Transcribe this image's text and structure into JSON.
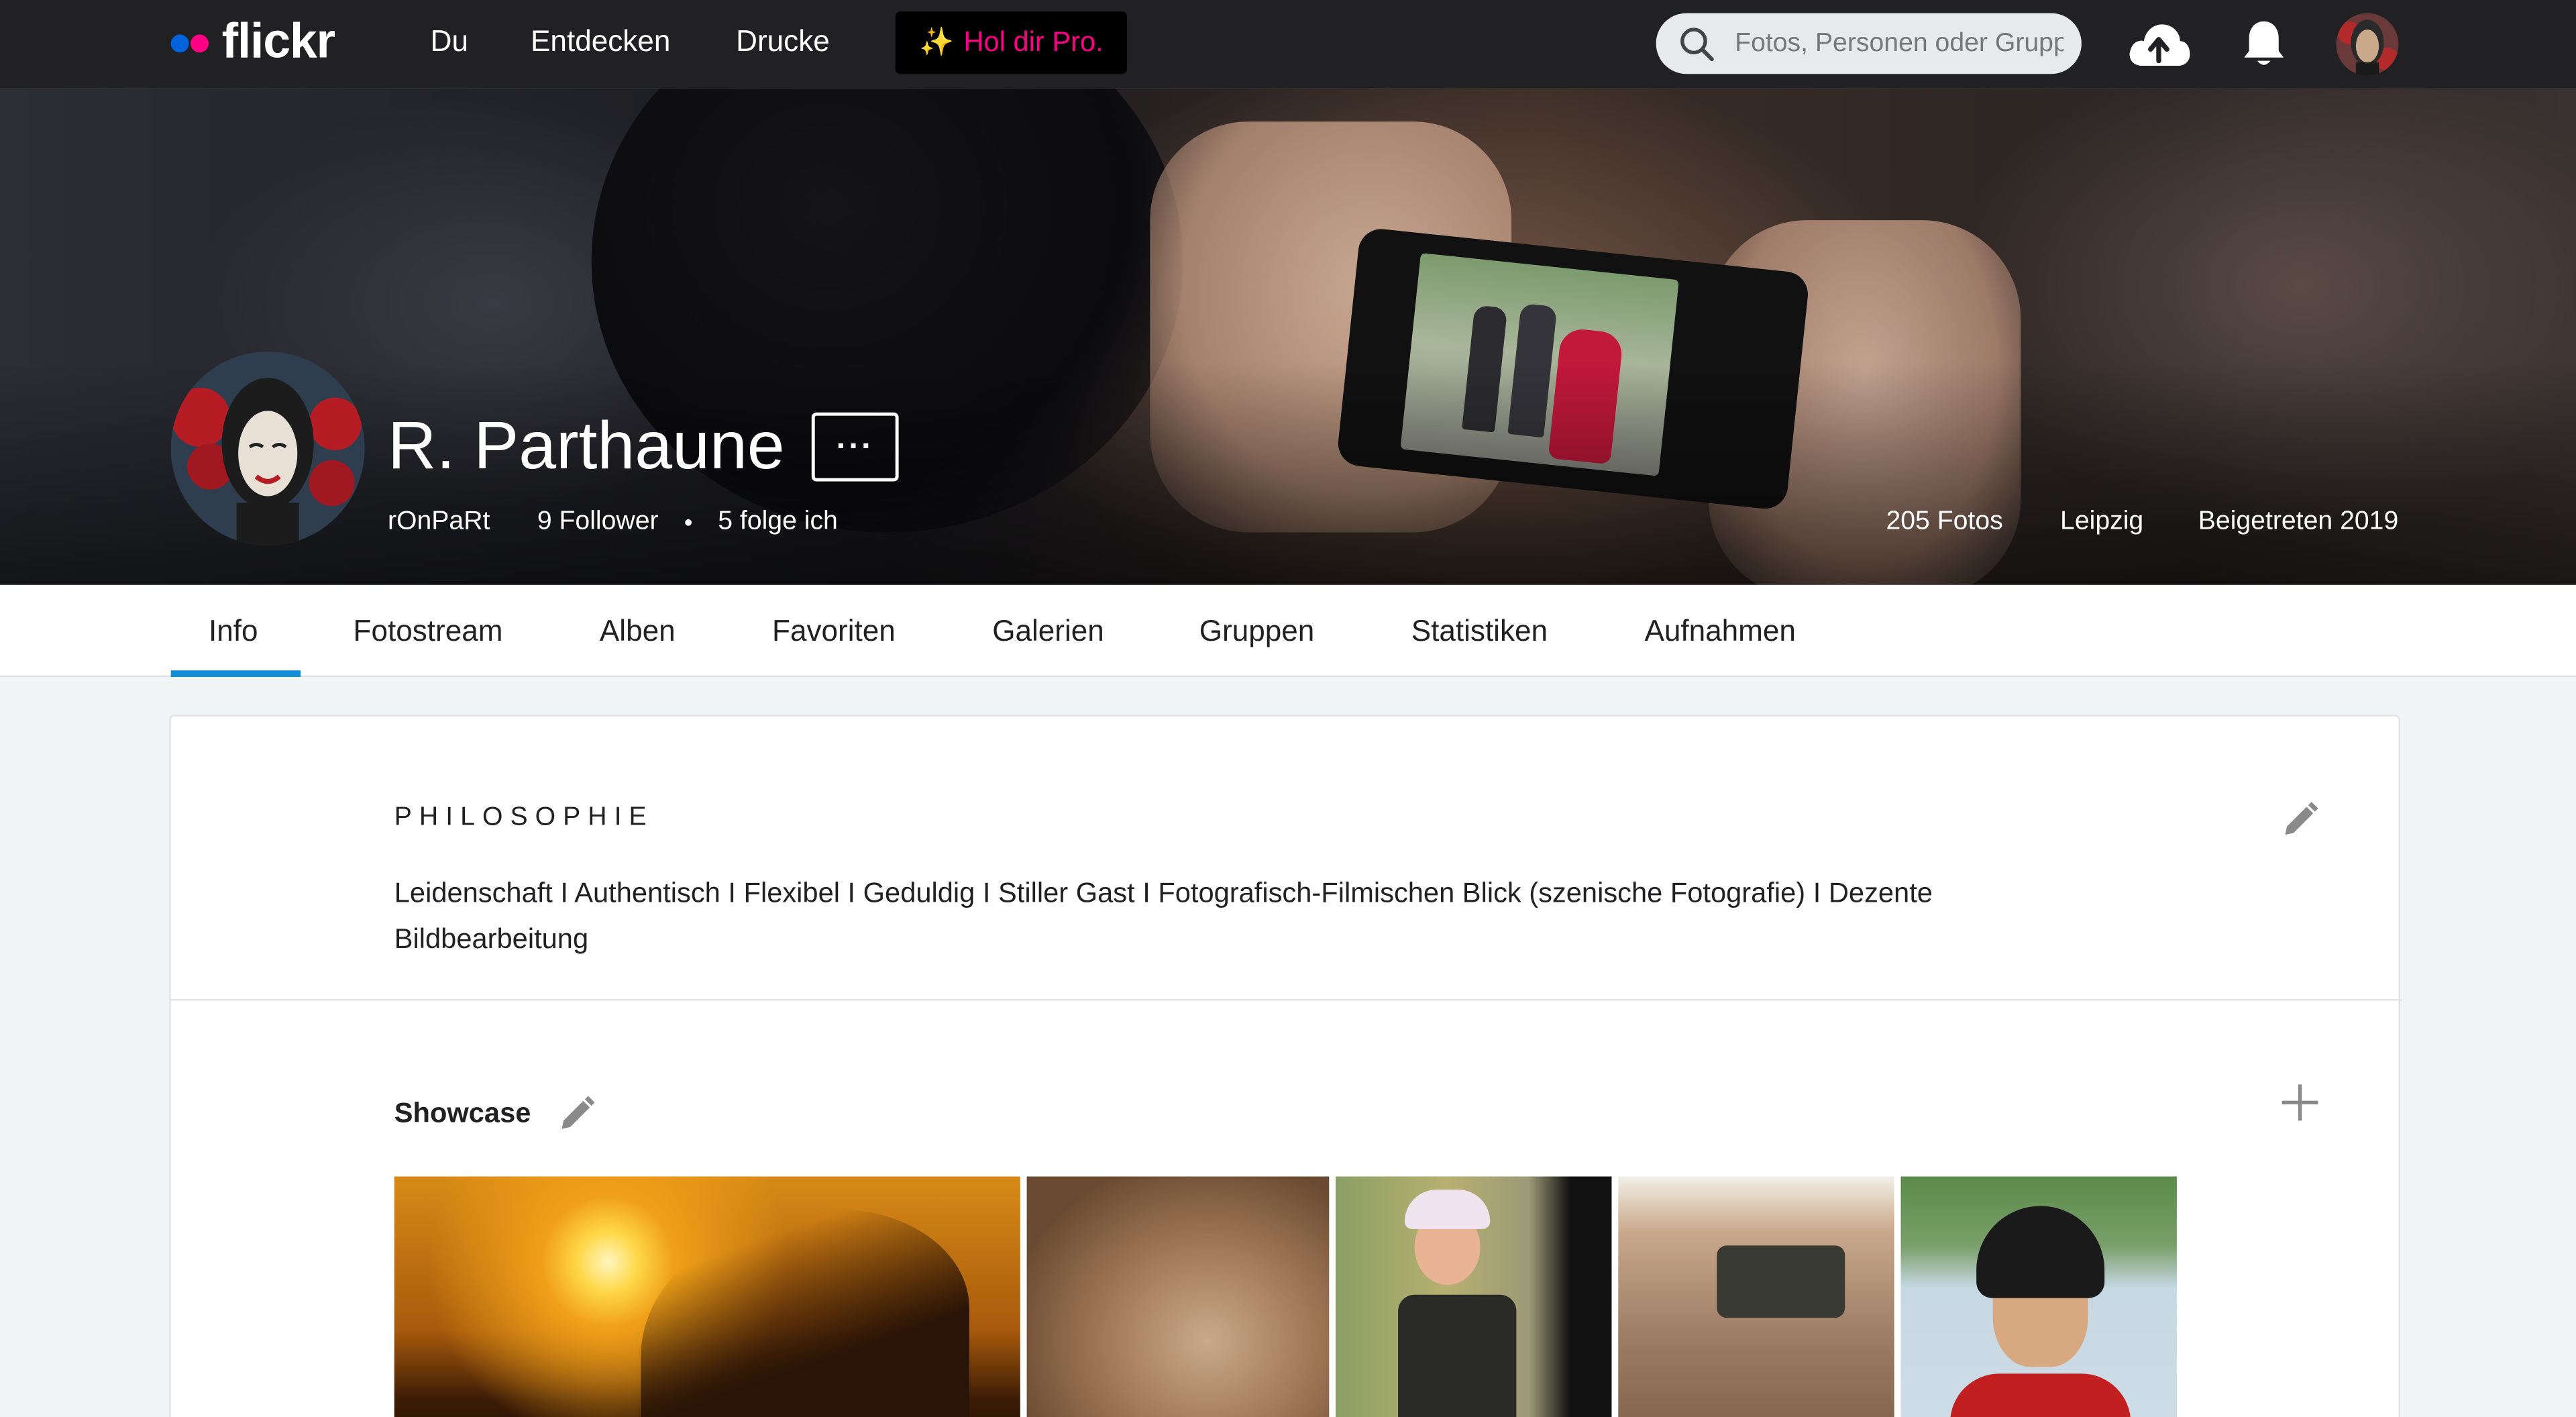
{
  "nav": {
    "logo": "flickr",
    "links": [
      "Du",
      "Entdecken",
      "Drucke"
    ],
    "pro_label": "Hol dir Pro.",
    "pro_spark": "✨",
    "search_placeholder": "Fotos, Personen oder Gruppen",
    "icons": [
      "search-icon",
      "upload-cloud-icon",
      "notification-bell-icon",
      "user-avatar"
    ]
  },
  "profile": {
    "name": "R. Parthaune",
    "more_label": "···",
    "username": "rOnPaRt",
    "followers": "9 Follower",
    "following": "5 folge ich",
    "photos": "205 Fotos",
    "location": "Leipzig",
    "joined": "Beigetreten 2019"
  },
  "tabs": {
    "items": [
      "Info",
      "Fotostream",
      "Alben",
      "Favoriten",
      "Galerien",
      "Gruppen",
      "Statistiken",
      "Aufnahmen"
    ],
    "active": "Info"
  },
  "about": {
    "philosophy_title": "PHILOSOPHIE",
    "philosophy_text": "Leidenschaft I Authentisch I Flexibel I Geduldig I Stiller Gast I Fotografisch-Filmischen Blick (szenische Fotografie) I Dezente Bildbearbeitung",
    "showcase_title": "Showcase"
  },
  "colors": {
    "nav_bg": "#212124",
    "accent_blue": "#0063dc",
    "accent_pink": "#ff0084",
    "tab_underline": "#128fdc",
    "page_bg": "#f2f5f6"
  }
}
